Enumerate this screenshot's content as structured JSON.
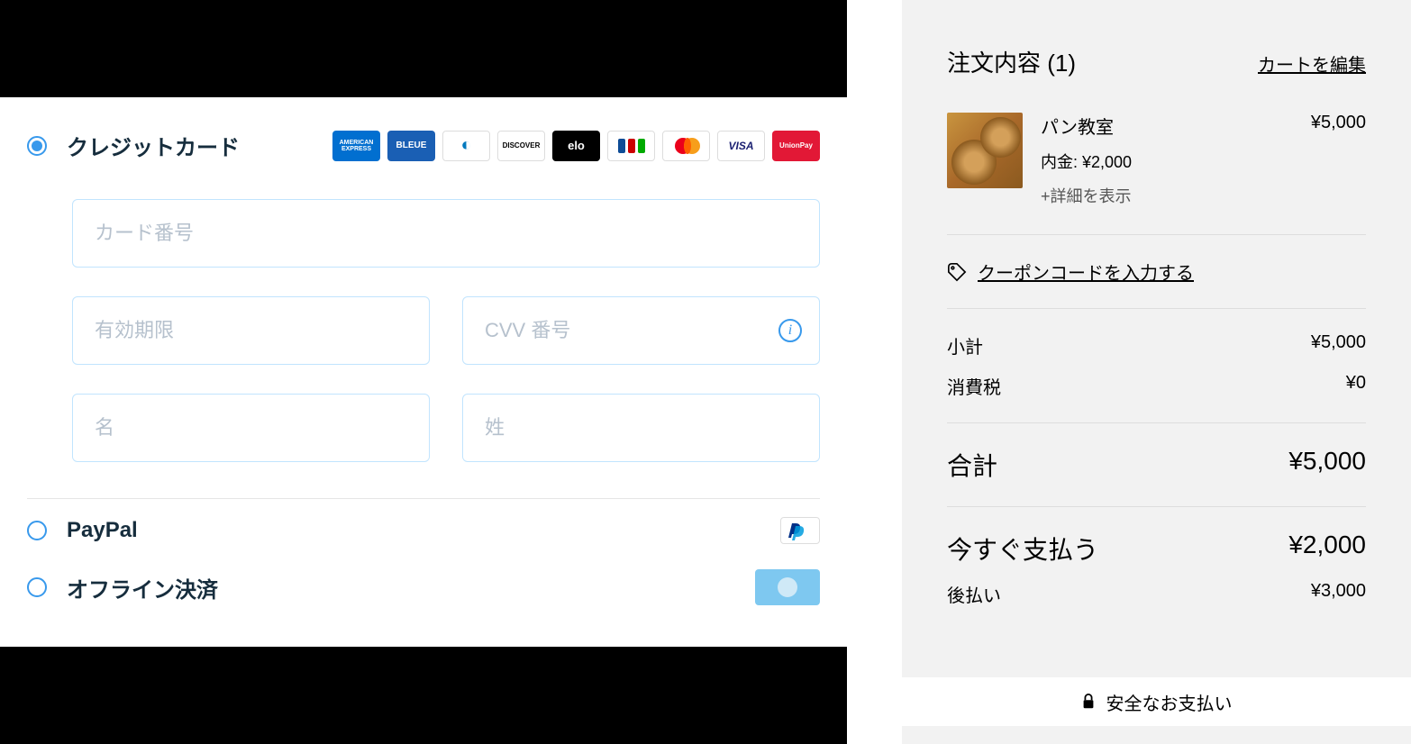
{
  "payment": {
    "credit_card_label": "クレジットカード",
    "paypal_label": "PayPal",
    "offline_label": "オフライン決済",
    "card_brands": [
      "AMEX",
      "BLEUE",
      "Diners",
      "DISCOVER",
      "elo",
      "JCB",
      "Mastercard",
      "VISA",
      "UnionPay"
    ],
    "fields": {
      "card_number_placeholder": "カード番号",
      "expiry_placeholder": "有効期限",
      "cvv_placeholder": "CVV 番号",
      "first_name_placeholder": "名",
      "last_name_placeholder": "姓"
    }
  },
  "order": {
    "title": "注文内容 (1)",
    "edit_cart": "カートを編集",
    "item": {
      "name": "パン教室",
      "price": "¥5,000",
      "deposit": "内金: ¥2,000",
      "more": "+詳細を表示"
    },
    "coupon_link": "クーポンコードを入力する",
    "subtotal_label": "小計",
    "subtotal_value": "¥5,000",
    "tax_label": "消費税",
    "tax_value": "¥0",
    "total_label": "合計",
    "total_value": "¥5,000",
    "paynow_label": "今すぐ支払う",
    "paynow_value": "¥2,000",
    "paylater_label": "後払い",
    "paylater_value": "¥3,000",
    "secure": "安全なお支払い"
  }
}
